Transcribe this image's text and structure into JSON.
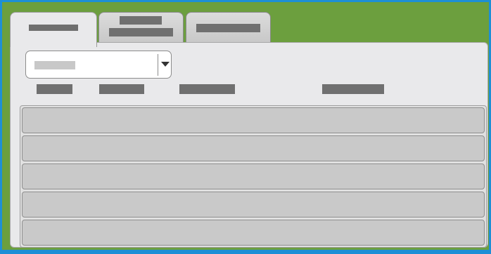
{
  "tabs": [
    {
      "label": "",
      "active": true
    },
    {
      "label": "",
      "active": false
    },
    {
      "label": "",
      "active": false
    }
  ],
  "dropdown": {
    "value": ""
  },
  "columns": [
    "",
    "",
    "",
    ""
  ],
  "rows": [
    "",
    "",
    "",
    "",
    ""
  ],
  "colors": {
    "frame_border": "#1e8fd6",
    "background": "#6c9f3e",
    "panel": "#e9e9eb",
    "row": "#c9c9c9"
  }
}
